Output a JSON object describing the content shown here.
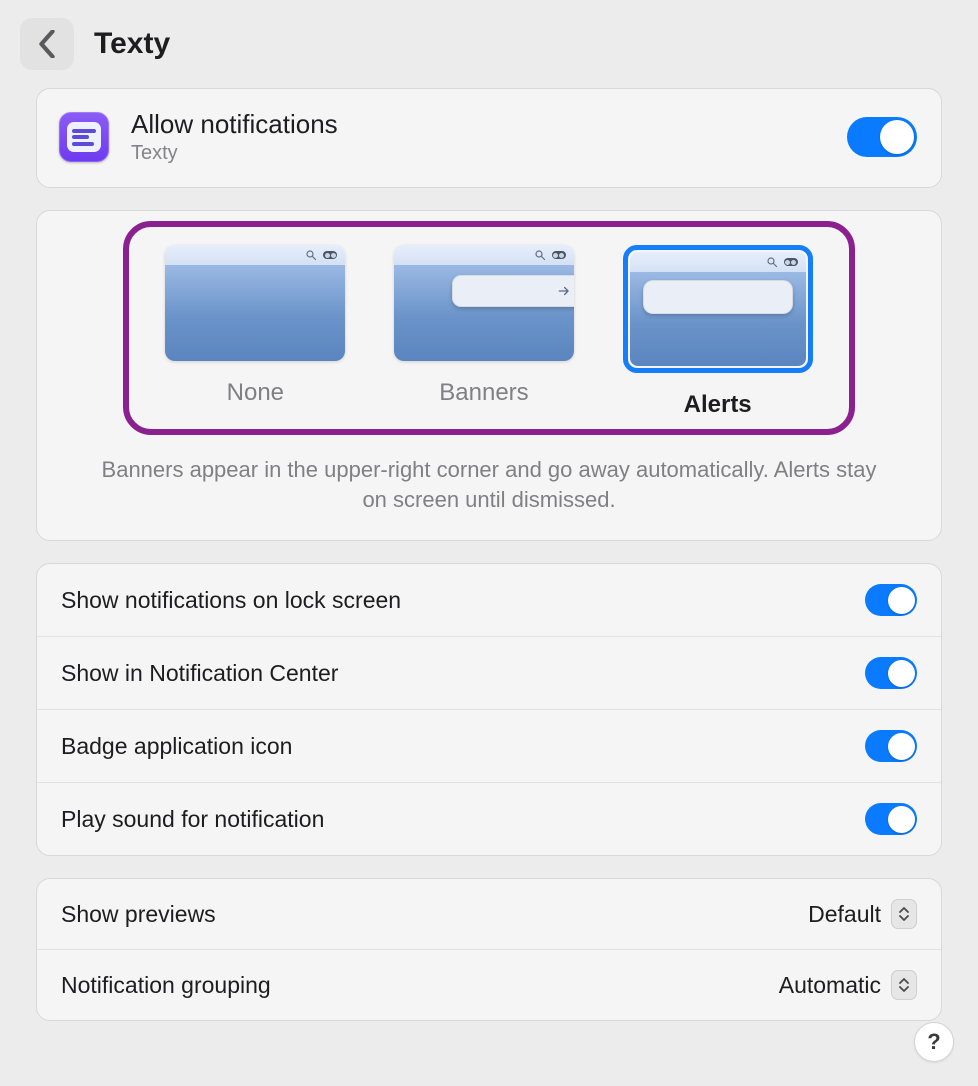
{
  "header": {
    "title": "Texty"
  },
  "allow": {
    "title": "Allow notifications",
    "subtitle": "Texty",
    "enabled": true
  },
  "style": {
    "options": [
      {
        "key": "none",
        "label": "None"
      },
      {
        "key": "banners",
        "label": "Banners"
      },
      {
        "key": "alerts",
        "label": "Alerts"
      }
    ],
    "selected": "alerts",
    "explanation": "Banners appear in the upper-right corner and go away automatically. Alerts stay on screen until dismissed."
  },
  "toggles": [
    {
      "key": "lock_screen",
      "label": "Show notifications on lock screen",
      "enabled": true
    },
    {
      "key": "notification_center",
      "label": "Show in Notification Center",
      "enabled": true
    },
    {
      "key": "badge",
      "label": "Badge application icon",
      "enabled": true
    },
    {
      "key": "sound",
      "label": "Play sound for notification",
      "enabled": true
    }
  ],
  "selects": [
    {
      "key": "previews",
      "label": "Show previews",
      "value": "Default"
    },
    {
      "key": "grouping",
      "label": "Notification grouping",
      "value": "Automatic"
    }
  ],
  "help": {
    "label": "?"
  }
}
